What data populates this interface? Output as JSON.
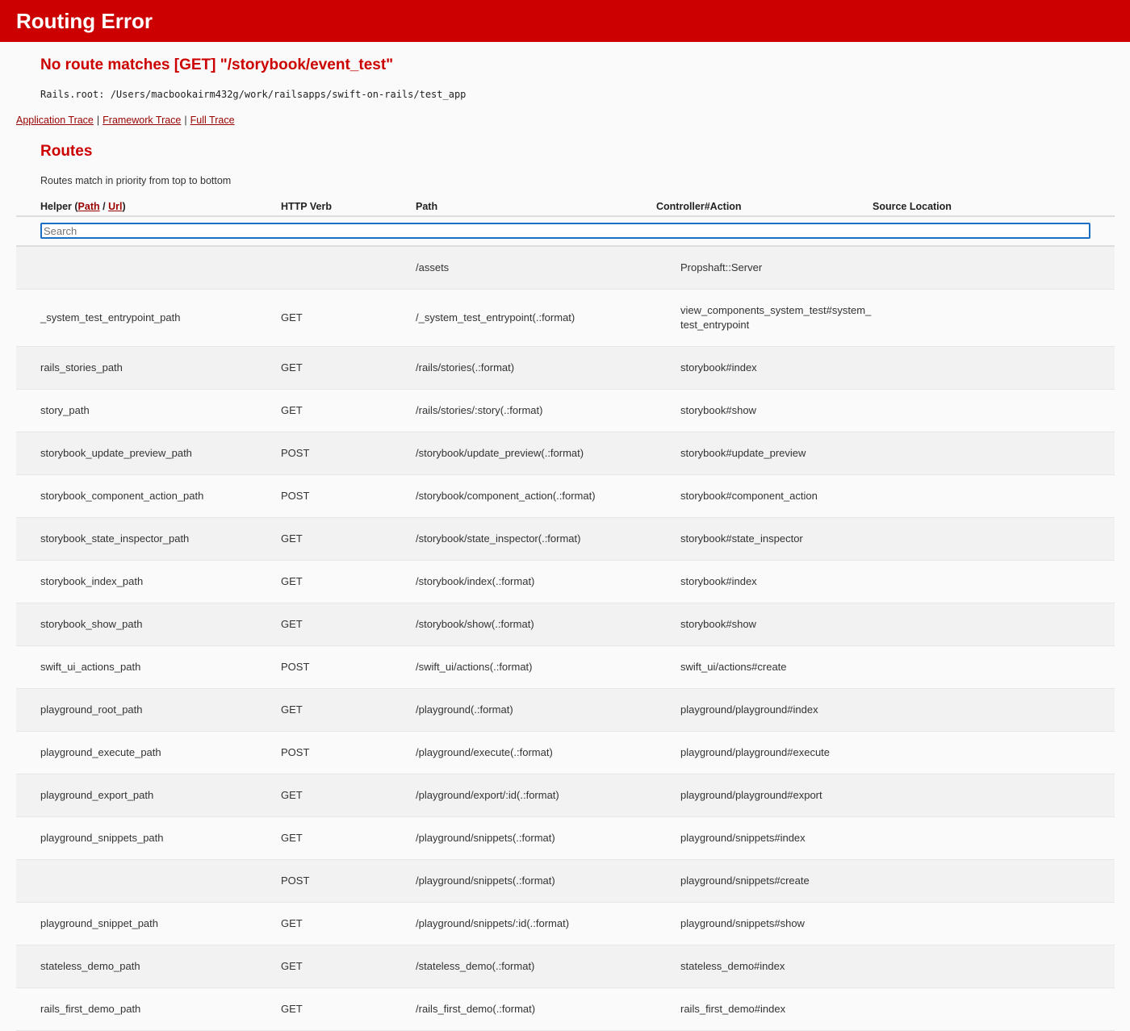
{
  "header": {
    "title": "Routing Error"
  },
  "error": {
    "message": "No route matches [GET] \"/storybook/event_test\"",
    "rails_root": "Rails.root: /Users/macbookairm432g/work/railsapps/swift-on-rails/test_app"
  },
  "traces": {
    "application": "Application Trace",
    "framework": "Framework Trace",
    "full": "Full Trace",
    "separator": "|"
  },
  "routes": {
    "title": "Routes",
    "note": "Routes match in priority from top to bottom",
    "columns": {
      "helper_prefix": "Helper (",
      "helper_path": "Path",
      "helper_slash": " / ",
      "helper_url": "Url",
      "helper_suffix": ")",
      "verb": "HTTP Verb",
      "path": "Path",
      "action": "Controller#Action",
      "source": "Source Location"
    },
    "search_placeholder": "Search",
    "rows": [
      {
        "helper": "",
        "verb": "",
        "path": "/assets",
        "action": "Propshaft::Server",
        "source": ""
      },
      {
        "helper": "_system_test_entrypoint_path",
        "verb": "GET",
        "path": "/_system_test_entrypoint(.:format)",
        "action": "view_components_system_test#system_test_entrypoint",
        "source": ""
      },
      {
        "helper": "rails_stories_path",
        "verb": "GET",
        "path": "/rails/stories(.:format)",
        "action": "storybook#index",
        "source": ""
      },
      {
        "helper": "story_path",
        "verb": "GET",
        "path": "/rails/stories/:story(.:format)",
        "action": "storybook#show",
        "source": ""
      },
      {
        "helper": "storybook_update_preview_path",
        "verb": "POST",
        "path": "/storybook/update_preview(.:format)",
        "action": "storybook#update_preview",
        "source": ""
      },
      {
        "helper": "storybook_component_action_path",
        "verb": "POST",
        "path": "/storybook/component_action(.:format)",
        "action": "storybook#component_action",
        "source": ""
      },
      {
        "helper": "storybook_state_inspector_path",
        "verb": "GET",
        "path": "/storybook/state_inspector(.:format)",
        "action": "storybook#state_inspector",
        "source": ""
      },
      {
        "helper": "storybook_index_path",
        "verb": "GET",
        "path": "/storybook/index(.:format)",
        "action": "storybook#index",
        "source": ""
      },
      {
        "helper": "storybook_show_path",
        "verb": "GET",
        "path": "/storybook/show(.:format)",
        "action": "storybook#show",
        "source": ""
      },
      {
        "helper": "swift_ui_actions_path",
        "verb": "POST",
        "path": "/swift_ui/actions(.:format)",
        "action": "swift_ui/actions#create",
        "source": ""
      },
      {
        "helper": "playground_root_path",
        "verb": "GET",
        "path": "/playground(.:format)",
        "action": "playground/playground#index",
        "source": ""
      },
      {
        "helper": "playground_execute_path",
        "verb": "POST",
        "path": "/playground/execute(.:format)",
        "action": "playground/playground#execute",
        "source": ""
      },
      {
        "helper": "playground_export_path",
        "verb": "GET",
        "path": "/playground/export/:id(.:format)",
        "action": "playground/playground#export",
        "source": ""
      },
      {
        "helper": "playground_snippets_path",
        "verb": "GET",
        "path": "/playground/snippets(.:format)",
        "action": "playground/snippets#index",
        "source": ""
      },
      {
        "helper": "",
        "verb": "POST",
        "path": "/playground/snippets(.:format)",
        "action": "playground/snippets#create",
        "source": ""
      },
      {
        "helper": "playground_snippet_path",
        "verb": "GET",
        "path": "/playground/snippets/:id(.:format)",
        "action": "playground/snippets#show",
        "source": ""
      },
      {
        "helper": "stateless_demo_path",
        "verb": "GET",
        "path": "/stateless_demo(.:format)",
        "action": "stateless_demo#index",
        "source": ""
      },
      {
        "helper": "rails_first_demo_path",
        "verb": "GET",
        "path": "/rails_first_demo(.:format)",
        "action": "rails_first_demo#index",
        "source": ""
      }
    ]
  }
}
